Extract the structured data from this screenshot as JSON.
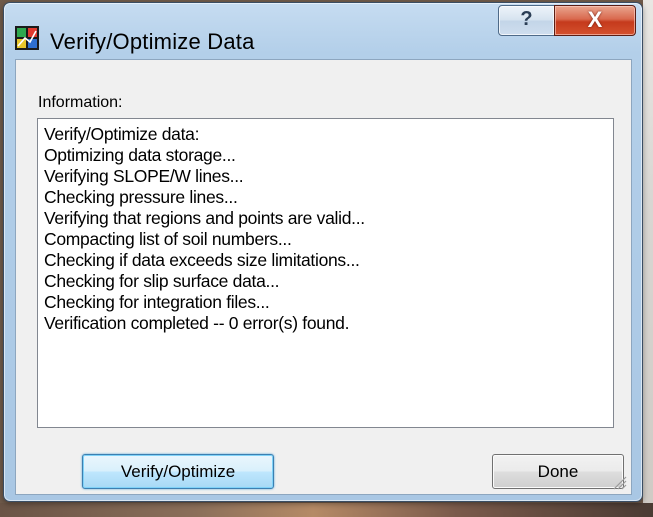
{
  "window": {
    "title": "Verify/Optimize Data",
    "help_label": "?",
    "close_label": "X"
  },
  "content": {
    "info_label": "Information:",
    "log_lines": [
      "Verify/Optimize data:",
      "Optimizing data storage...",
      "Verifying SLOPE/W lines...",
      "Checking pressure lines...",
      "Verifying that regions and points are valid...",
      "Compacting list of soil numbers...",
      "Checking if data exceeds size limitations...",
      "Checking for slip surface data...",
      "Checking for integration files...",
      "Verification completed -- 0 error(s) found."
    ]
  },
  "buttons": {
    "verify_label": "Verify/Optimize",
    "done_label": "Done"
  },
  "icons": {
    "app": "app-icon",
    "resize": "resize-grip-icon"
  },
  "colors": {
    "title_bar": "#b3cfe9",
    "close_button": "#c53a1c",
    "primary_button_border": "#3c7fb1"
  }
}
